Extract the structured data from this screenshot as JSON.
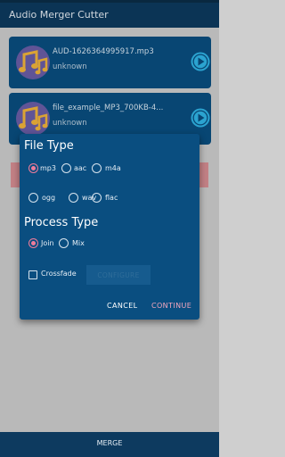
{
  "app": {
    "title": "Audio Merger Cutter"
  },
  "tracks": [
    {
      "filename": "AUD-1626364995917.mp3",
      "artist": "unknown"
    },
    {
      "filename": "file_example_MP3_700KB-4...",
      "artist": "unknown"
    }
  ],
  "dialog": {
    "file_type_title": "File Type",
    "file_types": [
      "mp3",
      "aac",
      "m4a",
      "ogg",
      "wav",
      "flac"
    ],
    "file_type_selected": "mp3",
    "process_type_title": "Process Type",
    "process_types": [
      "Join",
      "Mix"
    ],
    "process_type_selected": "Join",
    "crossfade_label": "Crossfade",
    "configure_label": "CONFIGURE",
    "cancel_label": "CANCEL",
    "continue_label": "CONTINUE"
  },
  "bottom": {
    "merge_label": "MERGE"
  },
  "colors": {
    "primary": "#0d3a5f",
    "card": "#0a4e80",
    "accent": "#f07c9a",
    "play": "#30b6e8"
  }
}
